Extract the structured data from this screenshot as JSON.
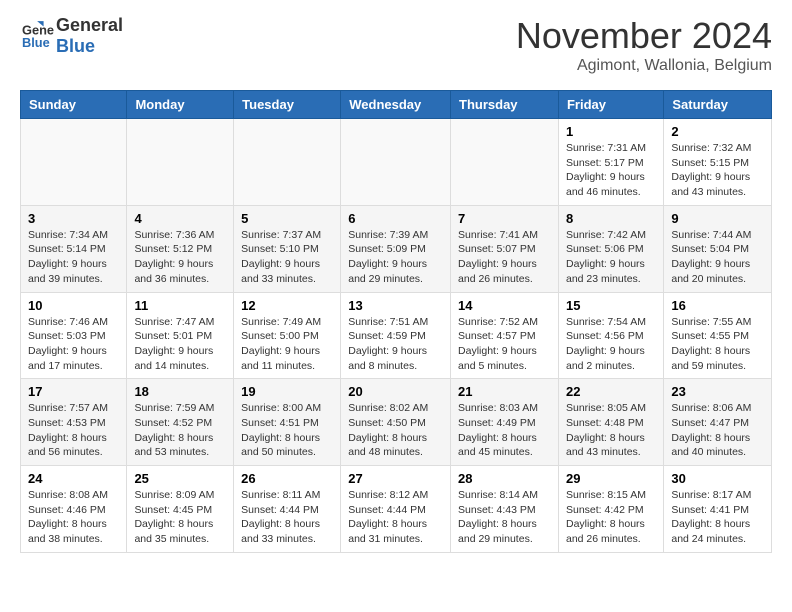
{
  "logo": {
    "general": "General",
    "blue": "Blue"
  },
  "header": {
    "month_title": "November 2024",
    "location": "Agimont, Wallonia, Belgium"
  },
  "days_of_week": [
    "Sunday",
    "Monday",
    "Tuesday",
    "Wednesday",
    "Thursday",
    "Friday",
    "Saturday"
  ],
  "weeks": [
    [
      {
        "day": "",
        "info": ""
      },
      {
        "day": "",
        "info": ""
      },
      {
        "day": "",
        "info": ""
      },
      {
        "day": "",
        "info": ""
      },
      {
        "day": "",
        "info": ""
      },
      {
        "day": "1",
        "info": "Sunrise: 7:31 AM\nSunset: 5:17 PM\nDaylight: 9 hours and 46 minutes."
      },
      {
        "day": "2",
        "info": "Sunrise: 7:32 AM\nSunset: 5:15 PM\nDaylight: 9 hours and 43 minutes."
      }
    ],
    [
      {
        "day": "3",
        "info": "Sunrise: 7:34 AM\nSunset: 5:14 PM\nDaylight: 9 hours and 39 minutes."
      },
      {
        "day": "4",
        "info": "Sunrise: 7:36 AM\nSunset: 5:12 PM\nDaylight: 9 hours and 36 minutes."
      },
      {
        "day": "5",
        "info": "Sunrise: 7:37 AM\nSunset: 5:10 PM\nDaylight: 9 hours and 33 minutes."
      },
      {
        "day": "6",
        "info": "Sunrise: 7:39 AM\nSunset: 5:09 PM\nDaylight: 9 hours and 29 minutes."
      },
      {
        "day": "7",
        "info": "Sunrise: 7:41 AM\nSunset: 5:07 PM\nDaylight: 9 hours and 26 minutes."
      },
      {
        "day": "8",
        "info": "Sunrise: 7:42 AM\nSunset: 5:06 PM\nDaylight: 9 hours and 23 minutes."
      },
      {
        "day": "9",
        "info": "Sunrise: 7:44 AM\nSunset: 5:04 PM\nDaylight: 9 hours and 20 minutes."
      }
    ],
    [
      {
        "day": "10",
        "info": "Sunrise: 7:46 AM\nSunset: 5:03 PM\nDaylight: 9 hours and 17 minutes."
      },
      {
        "day": "11",
        "info": "Sunrise: 7:47 AM\nSunset: 5:01 PM\nDaylight: 9 hours and 14 minutes."
      },
      {
        "day": "12",
        "info": "Sunrise: 7:49 AM\nSunset: 5:00 PM\nDaylight: 9 hours and 11 minutes."
      },
      {
        "day": "13",
        "info": "Sunrise: 7:51 AM\nSunset: 4:59 PM\nDaylight: 9 hours and 8 minutes."
      },
      {
        "day": "14",
        "info": "Sunrise: 7:52 AM\nSunset: 4:57 PM\nDaylight: 9 hours and 5 minutes."
      },
      {
        "day": "15",
        "info": "Sunrise: 7:54 AM\nSunset: 4:56 PM\nDaylight: 9 hours and 2 minutes."
      },
      {
        "day": "16",
        "info": "Sunrise: 7:55 AM\nSunset: 4:55 PM\nDaylight: 8 hours and 59 minutes."
      }
    ],
    [
      {
        "day": "17",
        "info": "Sunrise: 7:57 AM\nSunset: 4:53 PM\nDaylight: 8 hours and 56 minutes."
      },
      {
        "day": "18",
        "info": "Sunrise: 7:59 AM\nSunset: 4:52 PM\nDaylight: 8 hours and 53 minutes."
      },
      {
        "day": "19",
        "info": "Sunrise: 8:00 AM\nSunset: 4:51 PM\nDaylight: 8 hours and 50 minutes."
      },
      {
        "day": "20",
        "info": "Sunrise: 8:02 AM\nSunset: 4:50 PM\nDaylight: 8 hours and 48 minutes."
      },
      {
        "day": "21",
        "info": "Sunrise: 8:03 AM\nSunset: 4:49 PM\nDaylight: 8 hours and 45 minutes."
      },
      {
        "day": "22",
        "info": "Sunrise: 8:05 AM\nSunset: 4:48 PM\nDaylight: 8 hours and 43 minutes."
      },
      {
        "day": "23",
        "info": "Sunrise: 8:06 AM\nSunset: 4:47 PM\nDaylight: 8 hours and 40 minutes."
      }
    ],
    [
      {
        "day": "24",
        "info": "Sunrise: 8:08 AM\nSunset: 4:46 PM\nDaylight: 8 hours and 38 minutes."
      },
      {
        "day": "25",
        "info": "Sunrise: 8:09 AM\nSunset: 4:45 PM\nDaylight: 8 hours and 35 minutes."
      },
      {
        "day": "26",
        "info": "Sunrise: 8:11 AM\nSunset: 4:44 PM\nDaylight: 8 hours and 33 minutes."
      },
      {
        "day": "27",
        "info": "Sunrise: 8:12 AM\nSunset: 4:44 PM\nDaylight: 8 hours and 31 minutes."
      },
      {
        "day": "28",
        "info": "Sunrise: 8:14 AM\nSunset: 4:43 PM\nDaylight: 8 hours and 29 minutes."
      },
      {
        "day": "29",
        "info": "Sunrise: 8:15 AM\nSunset: 4:42 PM\nDaylight: 8 hours and 26 minutes."
      },
      {
        "day": "30",
        "info": "Sunrise: 8:17 AM\nSunset: 4:41 PM\nDaylight: 8 hours and 24 minutes."
      }
    ]
  ]
}
